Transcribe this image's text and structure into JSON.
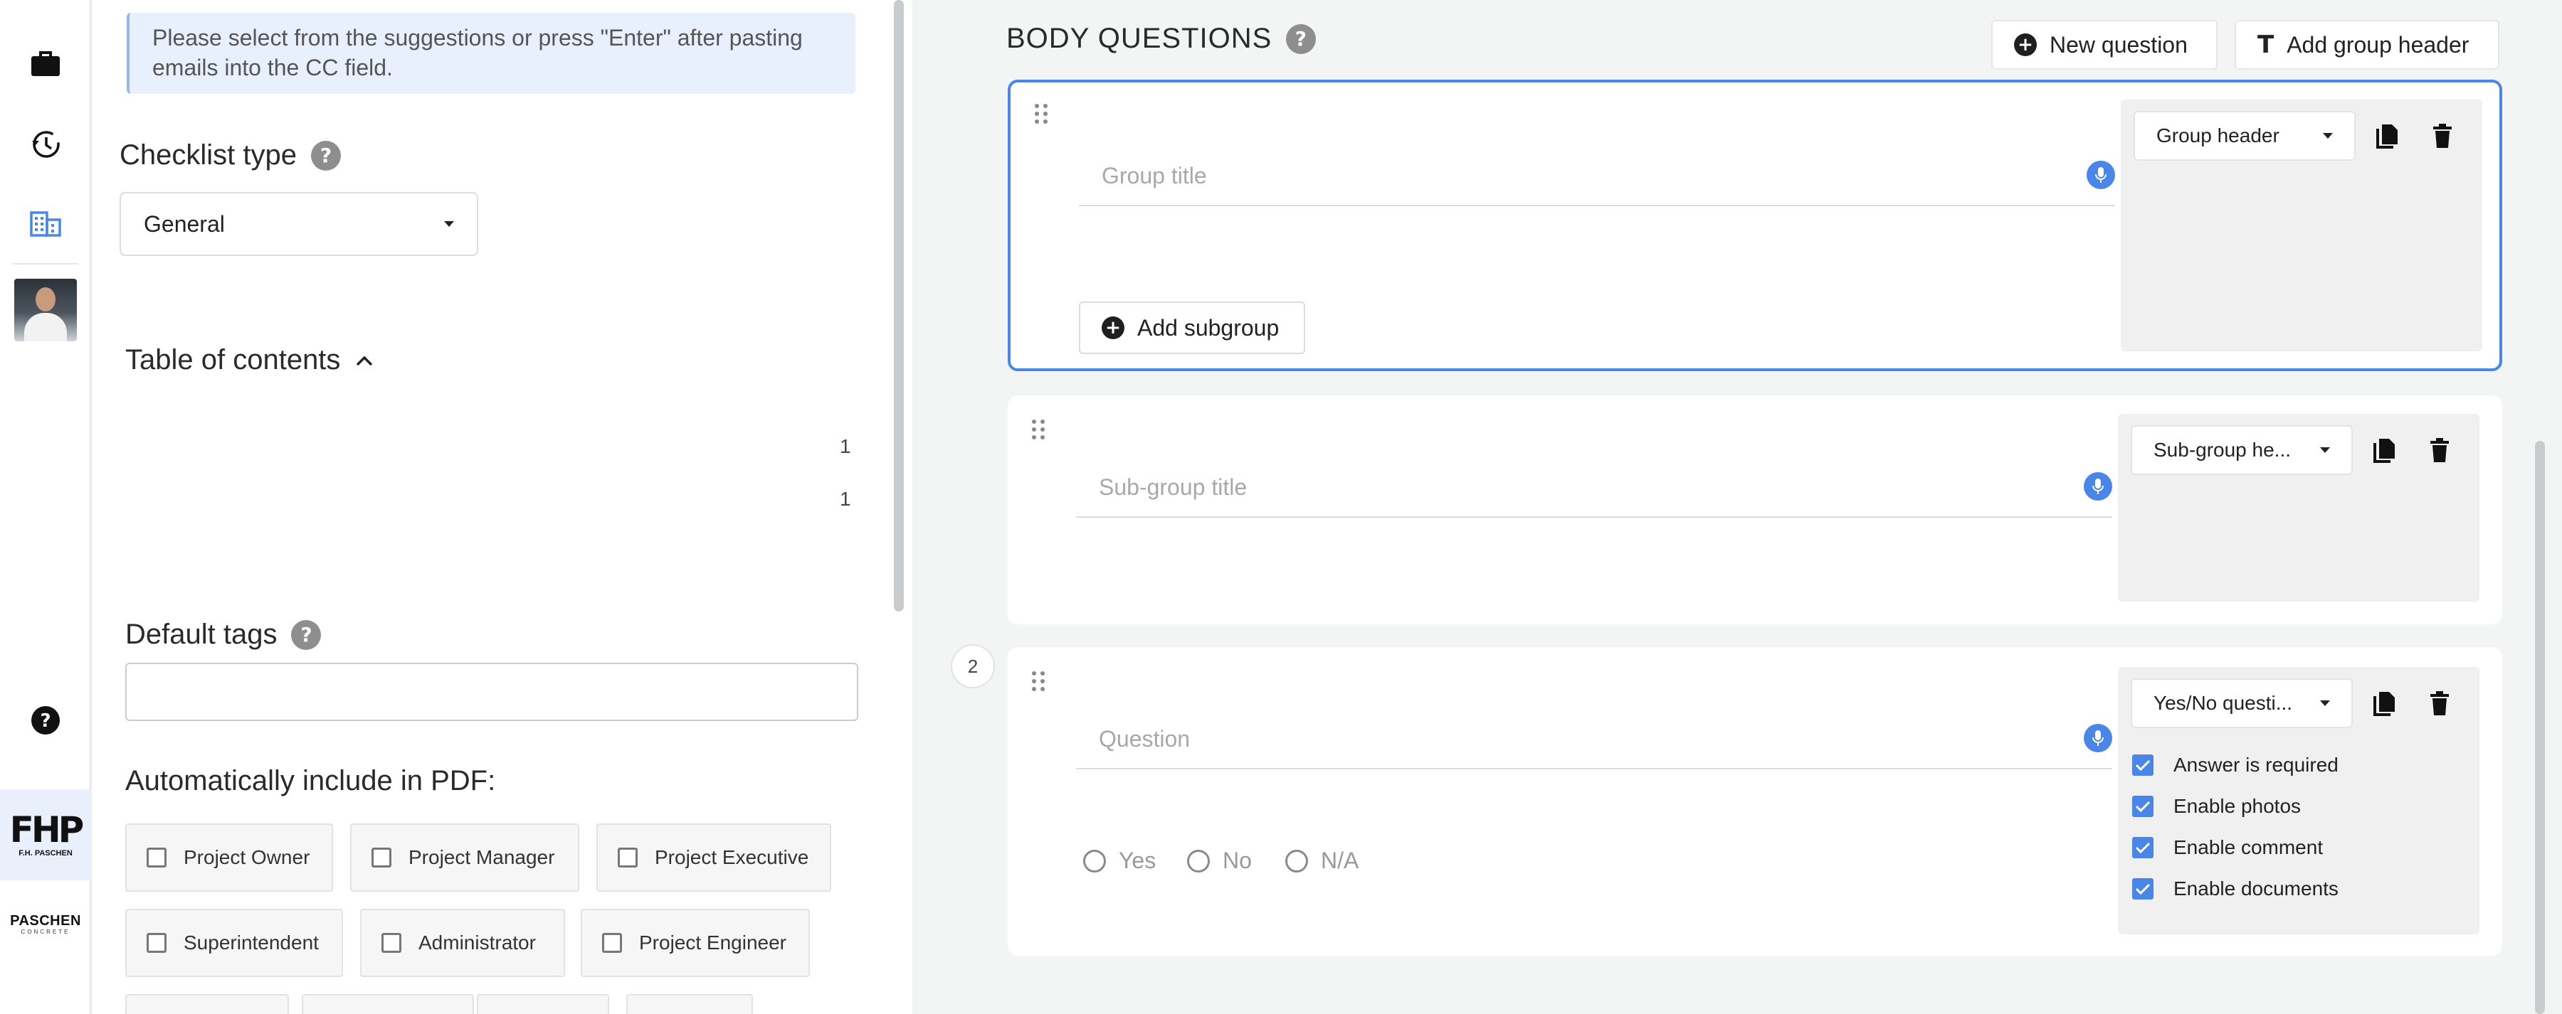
{
  "info": {
    "line1": "Please select from the suggestions or press \"Enter\" after pasting",
    "line2": "emails into the CC field."
  },
  "checklist_type": {
    "label": "Checklist type",
    "help": "?",
    "value": "General"
  },
  "toc": {
    "label": "Table of contents",
    "items": [
      "1",
      "1"
    ]
  },
  "default_tags": {
    "label": "Default tags",
    "help": "?",
    "value": ""
  },
  "auto_include": {
    "label": "Automatically include in PDF:",
    "roles": [
      "Project Owner",
      "Project Manager",
      "Project Executive",
      "Superintendent",
      "Administrator",
      "Project Engineer"
    ]
  },
  "body": {
    "title": "BODY QUESTIONS",
    "help": "?",
    "new_question": "New question",
    "add_group_header": "Add group header",
    "text_icon": "T"
  },
  "cards": [
    {
      "placeholder": "Group title",
      "type": "Group header",
      "add_subgroup": "Add subgroup"
    },
    {
      "placeholder": "Sub-group title",
      "type": "Sub-group he..."
    },
    {
      "number": "2",
      "placeholder": "Question",
      "type": "Yes/No questi...",
      "answers": [
        "Yes",
        "No",
        "N/A"
      ],
      "options": [
        "Answer is required",
        "Enable photos",
        "Enable comment",
        "Enable documents"
      ]
    }
  ],
  "logos": {
    "fhp_big": "FHP",
    "fhp_small": "F.H. PASCHEN",
    "paschen_big": "PASCHEN",
    "paschen_small": "CONCRETE"
  },
  "icons": {
    "rail": [
      "briefcase-icon",
      "history-icon",
      "building-icon",
      "help-icon"
    ],
    "card_actions": [
      "copy-icon",
      "delete-icon"
    ],
    "field": "microphone-icon",
    "drag": "drag-handle-icon"
  },
  "colors": {
    "accent": "#4a86e8",
    "info_bg": "#e8f0fd",
    "logo_fhp_bg": "#e9f0fb"
  }
}
